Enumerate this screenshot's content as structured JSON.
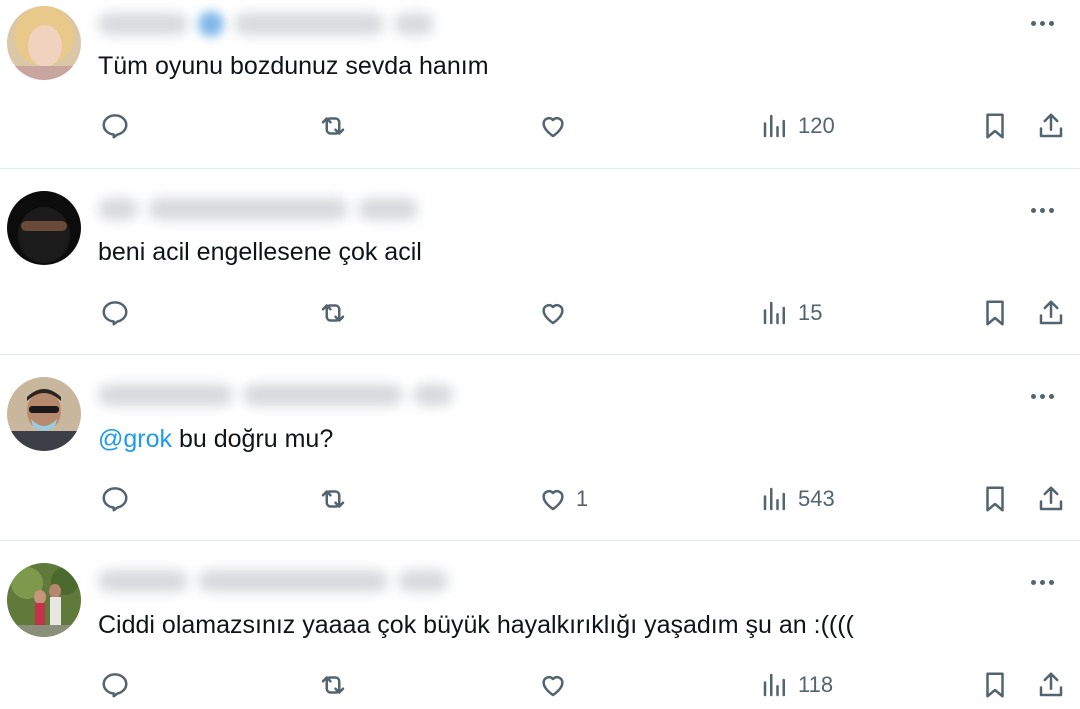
{
  "tweets": [
    {
      "text": "Tüm oyunu bozdunuz sevda hanım",
      "mention": "",
      "like_count": "",
      "view_count": "120"
    },
    {
      "text": "beni acil engellesene çok acil",
      "mention": "",
      "like_count": "",
      "view_count": "15"
    },
    {
      "text": "bu doğru mu?",
      "mention": "@grok",
      "like_count": "1",
      "view_count": "543"
    },
    {
      "text": "Ciddi olamazsınız yaaaa çok büyük hayalkırıklığı yaşadım şu an :((((",
      "mention": "",
      "like_count": "",
      "view_count": "118"
    }
  ],
  "icons": {
    "reply": "reply-icon",
    "retweet": "retweet-icon",
    "like": "heart-icon",
    "views": "views-chart-icon",
    "bookmark": "bookmark-icon",
    "share": "share-icon",
    "more": "more-dots-icon"
  },
  "colors": {
    "mention": "#1d9bf0",
    "icon": "#536471",
    "text": "#0f1419",
    "divider": "#e6ecf0"
  }
}
